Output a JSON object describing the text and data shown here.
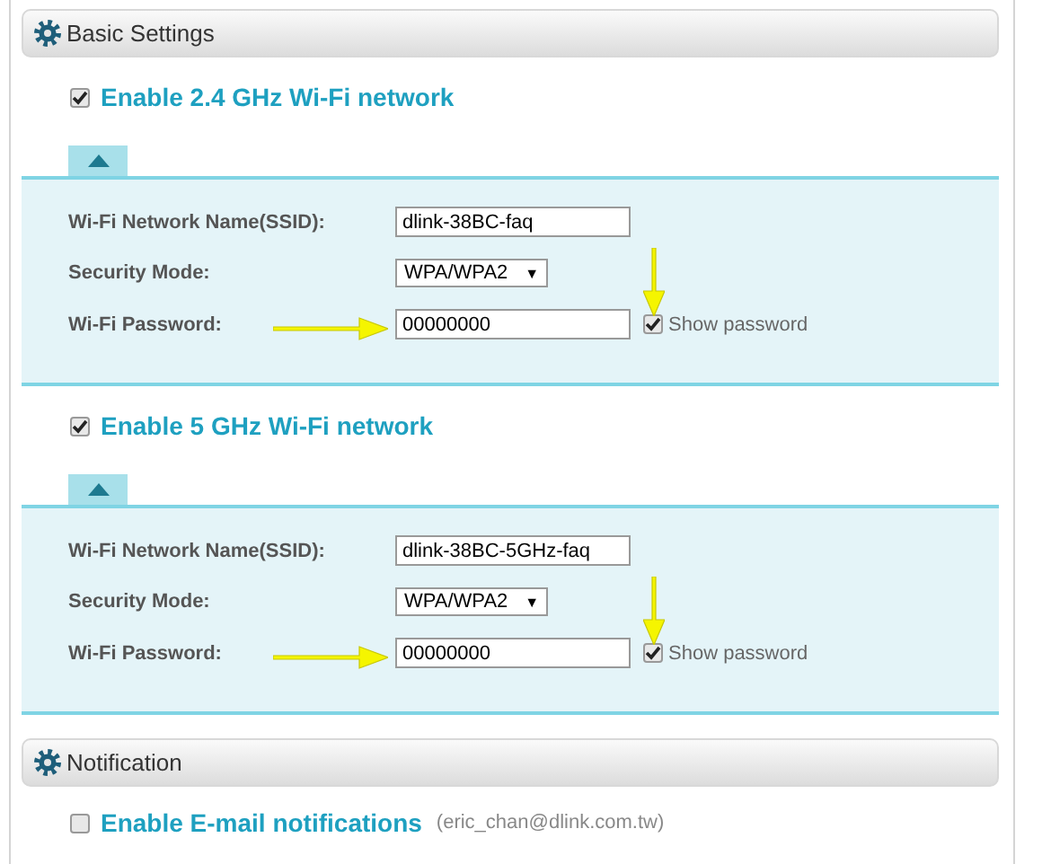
{
  "sections": [
    {
      "title": "Basic Settings",
      "kind": "wifi",
      "networks": [
        {
          "label": "Enable 2.4 GHz Wi-Fi network",
          "enabled": true,
          "expanded": true,
          "ssid_label": "Wi-Fi Network Name(SSID):",
          "ssid": "dlink-38BC-faq",
          "security_label": "Security Mode:",
          "security": "WPA/WPA2",
          "security_caret": "▼",
          "password_label": "Wi-Fi Password:",
          "password": "00000000",
          "show_password": true,
          "show_password_label": "Show password"
        },
        {
          "label": "Enable 5 GHz Wi-Fi network",
          "enabled": true,
          "expanded": true,
          "ssid_label": "Wi-Fi Network Name(SSID):",
          "ssid": "dlink-38BC-5GHz-faq",
          "security_label": "Security Mode:",
          "security": "WPA/WPA2",
          "security_caret": "▼",
          "password_label": "Wi-Fi Password:",
          "password": "00000000",
          "show_password": true,
          "show_password_label": "Show password"
        }
      ]
    },
    {
      "title": "Notification",
      "kind": "notification",
      "email": {
        "label": "Enable E-mail notifications",
        "address": "(eric_chan@dlink.com.tw)",
        "enabled": false
      }
    }
  ]
}
